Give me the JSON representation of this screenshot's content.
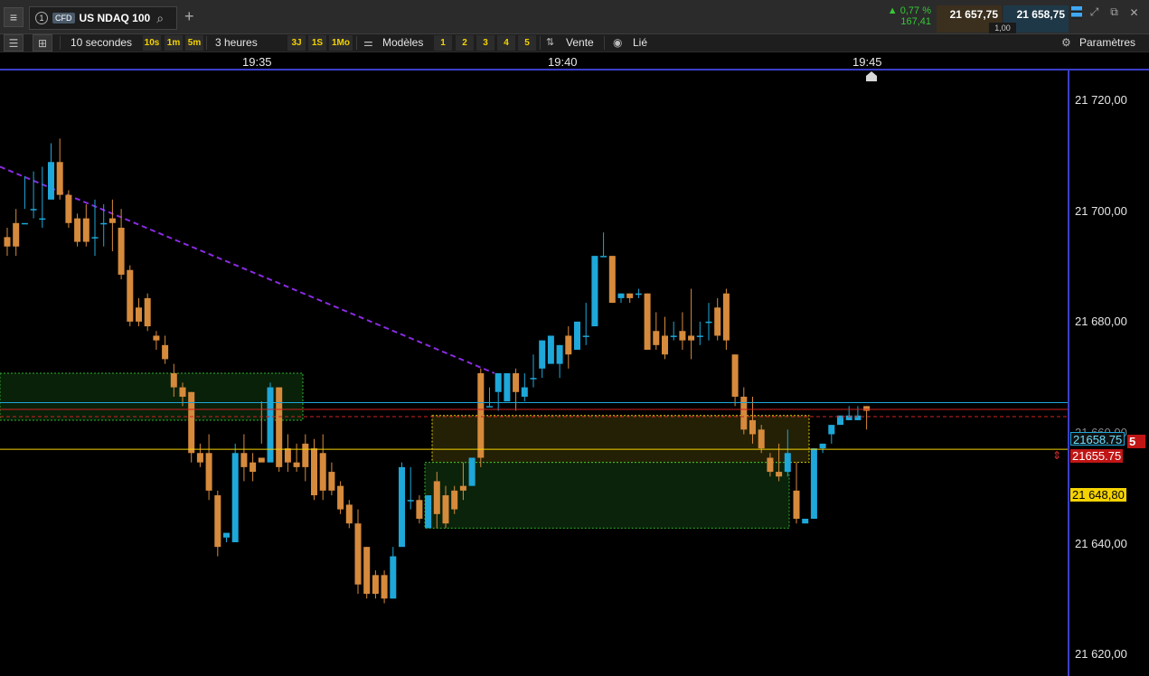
{
  "tabbar": {
    "menu_icon": "hamburger-menu-icon",
    "tab_number": "1",
    "tab_type": "CFD",
    "tab_title": "US NDAQ 100",
    "search_icon": "search-icon",
    "add_tab": "+",
    "change_pct": "▲ 0,77 %",
    "change_abs": "167,41",
    "bid": "21 657,75",
    "ask": "21 658,75",
    "spread": "1,00"
  },
  "toolbar": {
    "interval": "10 secondes",
    "interval_10s": "10s",
    "interval_1m": "1m",
    "interval_5m": "5m",
    "range": "3 heures",
    "range_3j": "3J",
    "range_1s": "1S",
    "range_1mo": "1Mo",
    "templates": "Modèles",
    "layouts": [
      "1",
      "2",
      "3",
      "4",
      "5"
    ],
    "side": "Vente",
    "linked": "Lié",
    "settings": "Paramètres"
  },
  "timeaxis": {
    "labels": [
      "19:35",
      "19:40",
      "19:45"
    ]
  },
  "colors": {
    "bull": "#1ea7d9",
    "bear": "#d68a3c",
    "accent_blue": "#3b3ec9",
    "yellow_line": "#f5d300",
    "red_line": "#d12222"
  },
  "chart_data": {
    "type": "candlestick",
    "instrument": "US NDAQ 100",
    "interval": "10 secondes",
    "x_ticks": [
      "19:35",
      "19:40",
      "19:45"
    ],
    "y_ticks": [
      "21 720,00",
      "21 700,00",
      "21 680,00",
      "21 640,00",
      "21 620,00"
    ],
    "ylim": [
      21600.5,
      21729.5
    ],
    "candles": [
      [
        21694,
        21696,
        21692,
        21690
      ],
      [
        21697,
        21700,
        21692,
        21690
      ],
      [
        21697,
        21707,
        21697,
        21700
      ],
      [
        21700,
        21708,
        21700,
        21698
      ],
      [
        21698,
        21709,
        21698,
        21696
      ],
      [
        21702,
        21702,
        21710,
        21714
      ],
      [
        21710,
        21715,
        21703,
        21702
      ],
      [
        21703,
        21704,
        21697,
        21696
      ],
      [
        21698,
        21699,
        21693,
        21692
      ],
      [
        21698,
        21701,
        21693,
        21692
      ],
      [
        21694,
        21702,
        21694,
        21690
      ],
      [
        21697,
        21701,
        21697,
        21692
      ],
      [
        21698,
        21702,
        21697,
        21691
      ],
      [
        21696,
        21700,
        21686,
        21685
      ],
      [
        21687,
        21688,
        21676,
        21675
      ],
      [
        21679,
        21681,
        21676,
        21675
      ],
      [
        21681,
        21682,
        21675,
        21674
      ],
      [
        21673,
        21674,
        21672,
        21670
      ],
      [
        21671,
        21673,
        21668,
        21667
      ],
      [
        21665,
        21667,
        21662,
        21660
      ],
      [
        21662,
        21663,
        21660,
        21658
      ],
      [
        21661,
        21661,
        21648,
        21646
      ],
      [
        21648,
        21650,
        21646,
        21645
      ],
      [
        21648,
        21652,
        21640,
        21638
      ],
      [
        21639,
        21640,
        21628,
        21626
      ],
      [
        21630,
        21630,
        21631,
        21629
      ],
      [
        21629,
        21631,
        21648,
        21650
      ],
      [
        21648,
        21652,
        21645,
        21642
      ],
      [
        21646,
        21648,
        21644,
        21642
      ],
      [
        21647,
        21659,
        21646,
        21650
      ],
      [
        21646,
        21663,
        21662,
        21647
      ],
      [
        21662,
        21662,
        21645,
        21644
      ],
      [
        21649,
        21652,
        21646,
        21644
      ],
      [
        21646,
        21650,
        21645,
        21644
      ],
      [
        21650,
        21652,
        21645,
        21642
      ],
      [
        21649,
        21651,
        21639,
        21638
      ],
      [
        21648,
        21652,
        21640,
        21638
      ],
      [
        21644,
        21646,
        21640,
        21639
      ],
      [
        21641,
        21642,
        21636,
        21635
      ],
      [
        21637,
        21638,
        21633,
        21632
      ],
      [
        21633,
        21636,
        21620,
        21618
      ],
      [
        21628,
        21628,
        21618,
        21617
      ],
      [
        21622,
        21623,
        21618,
        21617
      ],
      [
        21622,
        21623,
        21617,
        21616
      ],
      [
        21617,
        21617,
        21626,
        21628
      ],
      [
        21628,
        21629,
        21645,
        21646
      ],
      [
        21638,
        21645,
        21638,
        21636
      ],
      [
        21638,
        21639,
        21634,
        21633
      ],
      [
        21632,
        21636,
        21639,
        21632
      ],
      [
        21642,
        21644,
        21635,
        21632
      ],
      [
        21639,
        21641,
        21633,
        21632
      ],
      [
        21640,
        21641,
        21636,
        21635
      ],
      [
        21641,
        21646,
        21640,
        21638
      ],
      [
        21641,
        21647,
        21647,
        21641
      ],
      [
        21665,
        21666,
        21647,
        21645
      ],
      [
        21658,
        21662,
        21658,
        21658
      ],
      [
        21661,
        21661,
        21665,
        21657
      ],
      [
        21659,
        21660,
        21665,
        21663
      ],
      [
        21665,
        21666,
        21661,
        21657
      ],
      [
        21660,
        21665,
        21662,
        21659
      ],
      [
        21664,
        21669,
        21664,
        21662
      ],
      [
        21666,
        21672,
        21672,
        21664
      ],
      [
        21667,
        21669,
        21673,
        21671
      ],
      [
        21667,
        21671,
        21671,
        21664
      ],
      [
        21673,
        21675,
        21669,
        21666
      ],
      [
        21670,
        21676,
        21676,
        21670
      ],
      [
        21673,
        21680,
        21673,
        21671
      ],
      [
        21675,
        21690,
        21690,
        21675
      ],
      [
        21690,
        21695,
        21690,
        21690
      ],
      [
        21690,
        21690,
        21680,
        21680
      ],
      [
        21681,
        21682,
        21682,
        21680
      ],
      [
        21682,
        21682,
        21681,
        21680
      ],
      [
        21682,
        21683,
        21682,
        21681
      ],
      [
        21682,
        21682,
        21670,
        21670
      ],
      [
        21674,
        21678,
        21671,
        21670
      ],
      [
        21673,
        21677,
        21669,
        21668
      ],
      [
        21673,
        21676,
        21673,
        21672
      ],
      [
        21674,
        21678,
        21672,
        21670
      ],
      [
        21673,
        21683,
        21672,
        21668
      ],
      [
        21673,
        21676,
        21673,
        21671
      ],
      [
        21676,
        21680,
        21676,
        21672
      ],
      [
        21679,
        21681,
        21673,
        21672
      ],
      [
        21682,
        21683,
        21672,
        21670
      ],
      [
        21669,
        21669,
        21660,
        21658
      ],
      [
        21660,
        21662,
        21653,
        21652
      ],
      [
        21655,
        21660,
        21652,
        21650
      ],
      [
        21653,
        21654,
        21649,
        21648
      ],
      [
        21647,
        21648,
        21644,
        21643
      ],
      [
        21644,
        21650,
        21643,
        21642
      ],
      [
        21644,
        21653,
        21648,
        21643
      ],
      [
        21640,
        21646,
        21634,
        21633
      ],
      [
        21633,
        21634,
        21634,
        21633
      ],
      [
        21634,
        21636,
        21649,
        21649
      ],
      [
        21649,
        21650,
        21650,
        21648
      ],
      [
        21652,
        21654,
        21654,
        21650
      ],
      [
        21654,
        21655,
        21656,
        21654
      ],
      [
        21655,
        21658,
        21656,
        21655
      ],
      [
        21655,
        21658,
        21656,
        21655
      ],
      [
        21658,
        21658,
        21657,
        21653
      ]
    ],
    "price_tags": {
      "ask": "21658.75",
      "bid": "21655.75",
      "level": "21 648,80",
      "hidden_tick": "21 660,00",
      "badge": "5"
    }
  }
}
